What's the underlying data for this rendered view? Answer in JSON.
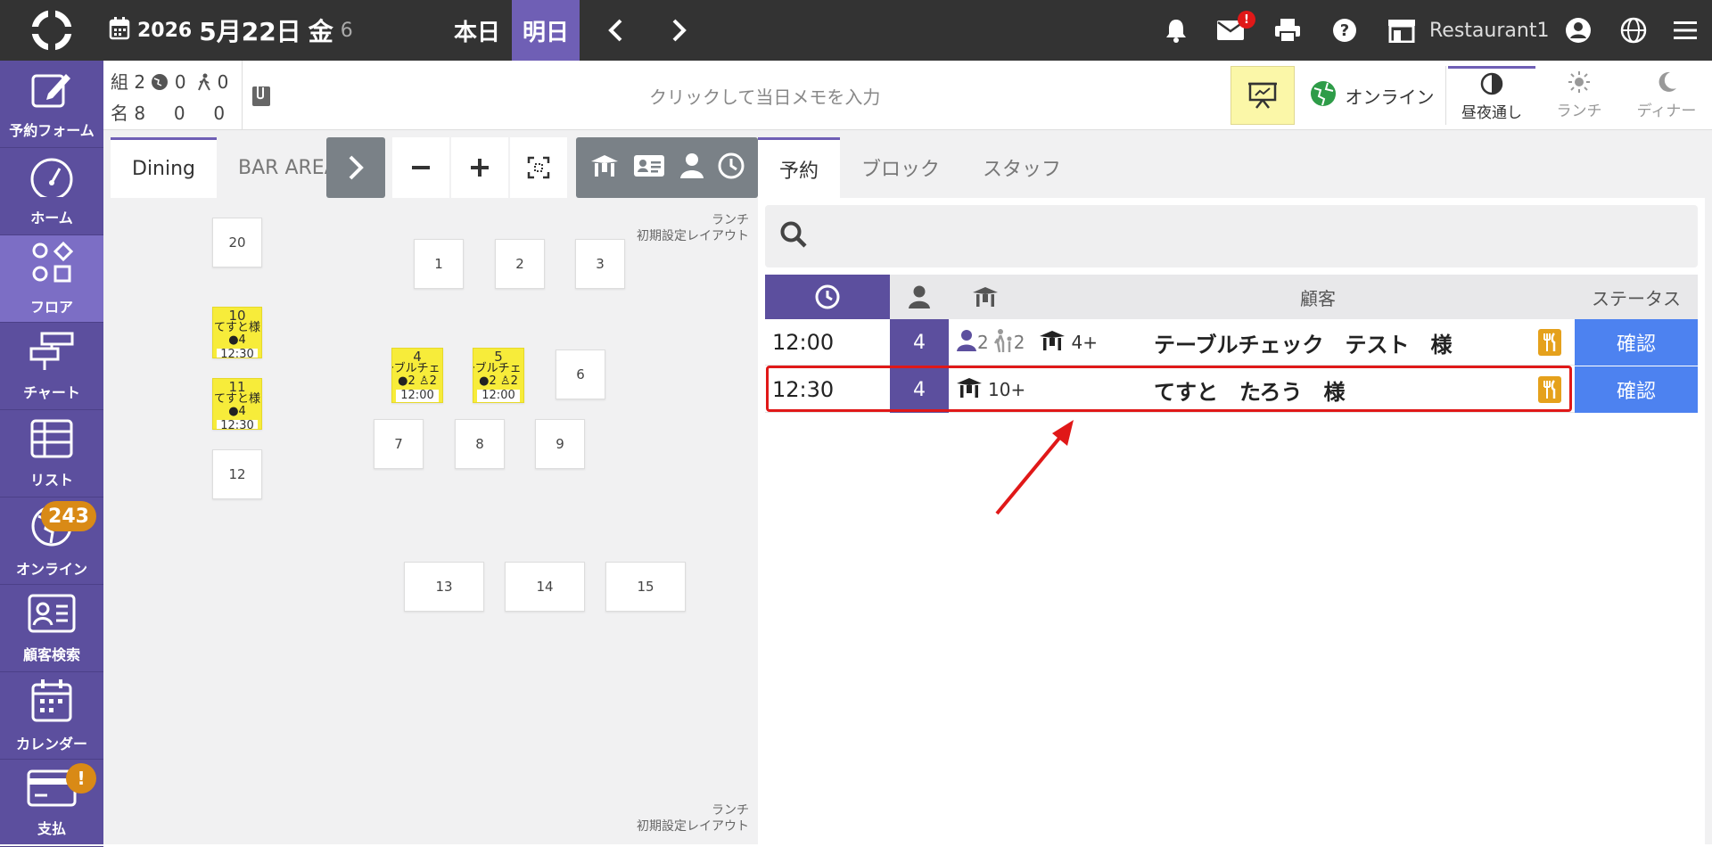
{
  "topbar": {
    "year": "2026",
    "month_day": "5月22日",
    "weekday": "金",
    "weekday_num": "6",
    "today_label": "本日",
    "tomorrow_label": "明日",
    "mail_badge": "!",
    "restaurant_name": "Restaurant1"
  },
  "sidebar": {
    "items": [
      {
        "label": "予約フォーム"
      },
      {
        "label": "ホーム"
      },
      {
        "label": "フロア"
      },
      {
        "label": "チャート"
      },
      {
        "label": "リスト"
      },
      {
        "label": "オンライン",
        "badge": "243"
      },
      {
        "label": "顧客検索"
      },
      {
        "label": "カレンダー"
      },
      {
        "label": "支払",
        "badge": "!"
      }
    ]
  },
  "infobar": {
    "groups_label": "組",
    "groups_value": "2",
    "web_value": "0",
    "walkin_value": "0",
    "people_label": "名",
    "people_value": "8",
    "people_web": "0",
    "people_walkin": "0",
    "memo_placeholder": "クリックして当日メモを入力",
    "online_label": "オンライン",
    "meals": [
      {
        "label": "昼夜通し"
      },
      {
        "label": "ランチ"
      },
      {
        "label": "ディナー"
      }
    ]
  },
  "floor": {
    "tabs": [
      "Dining",
      "BAR AREA"
    ],
    "layout_note_line1": "ランチ",
    "layout_note_line2": "初期設定レイアウト",
    "tables": {
      "t1": "1",
      "t2": "2",
      "t3": "3",
      "t6": "6",
      "t7": "7",
      "t8": "8",
      "t9": "9",
      "t12": "12",
      "t13": "13",
      "t14": "14",
      "t15": "15",
      "t20": "20"
    },
    "occupied": {
      "t10": {
        "num": "10",
        "name": "てすと様",
        "guests": "4",
        "time": "12:30"
      },
      "t11": {
        "num": "11",
        "name": "てすと様",
        "guests": "4",
        "time": "12:30"
      },
      "t4": {
        "num": "4",
        "name": "テーブルチェック",
        "guests": "2",
        "kids": "2",
        "time": "12:00"
      },
      "t5": {
        "num": "5",
        "name": "テーブルチェック",
        "guests": "2",
        "kids": "2",
        "time": "12:00"
      }
    }
  },
  "reservations": {
    "tabs": [
      "予約",
      "ブロック",
      "スタッフ"
    ],
    "header_customer": "顧客",
    "header_status": "ステータス",
    "rows": [
      {
        "time": "12:00",
        "guests": "4",
        "adults": "2",
        "children": "2",
        "table": "4+",
        "name": "テーブルチェック　テスト　様",
        "status": "確認"
      },
      {
        "time": "12:30",
        "guests": "4",
        "table": "10+",
        "name": "てすと　たろう　様",
        "status": "確認"
      }
    ]
  },
  "colors": {
    "purple": "#5c4f9e",
    "accent": "#6f5fb5",
    "status_blue": "#4d82f0",
    "highlight_red": "#e01818",
    "occupied_yellow": "#f7ec3a"
  }
}
